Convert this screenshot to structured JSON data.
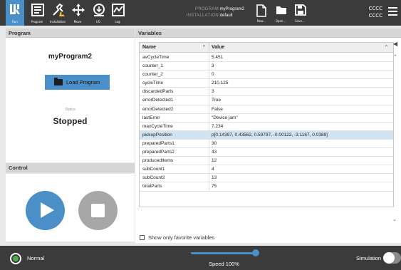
{
  "nav": {
    "run": "Run",
    "program": "Program",
    "installation": "Installation",
    "move": "Move",
    "io": "I/O",
    "log": "Log"
  },
  "header": {
    "program_label": "PROGRAM",
    "program_value": "myProgram2",
    "installation_label": "INSTALLATION",
    "installation_value": "default",
    "new_label": "New...",
    "open_label": "Open...",
    "save_label": "Save...",
    "right_line1": "CCCC",
    "right_line2": "CCCC"
  },
  "program_pane": {
    "title": "Program",
    "program_name": "myProgram2",
    "load_button": "Load Program",
    "status_label": "Status",
    "status_value": "Stopped"
  },
  "control_pane": {
    "title": "Control"
  },
  "variables": {
    "title": "Variables",
    "col_name": "Name",
    "col_value": "Value",
    "sort_glyph_name": "^",
    "sort_glyph_value": "^",
    "rows": [
      {
        "name": "avCycleTime",
        "value": "5.451"
      },
      {
        "name": "counter_1",
        "value": "3"
      },
      {
        "name": "counter_2",
        "value": "0"
      },
      {
        "name": "cycleTime",
        "value": "210.125"
      },
      {
        "name": "discardedParts",
        "value": "3"
      },
      {
        "name": "errorDetected1",
        "value": "True"
      },
      {
        "name": "errorDetected2",
        "value": "False"
      },
      {
        "name": "lastError",
        "value": "\"Device jam\""
      },
      {
        "name": "maxCycleTime",
        "value": "7.234"
      },
      {
        "name": "pickupPosition",
        "value": "p[0.14397, 0.43562, 0.59797, -0.00122, -3.1167, 0.0389]"
      },
      {
        "name": "preparedParts1",
        "value": "30"
      },
      {
        "name": "preparedParts2",
        "value": "43"
      },
      {
        "name": "producedItems",
        "value": "12"
      },
      {
        "name": "subCount1",
        "value": "4"
      },
      {
        "name": "subCount2",
        "value": "13"
      },
      {
        "name": "totalParts",
        "value": "75"
      }
    ],
    "favorite_label": "Show only favorite variables"
  },
  "footer": {
    "status_text": "Normal",
    "speed_text": "Speed 100%",
    "speed_percent": 100,
    "simulation_label": "Simulation"
  },
  "colors": {
    "accent": "#4a8fc7",
    "header_bg": "#3b3b3b",
    "selected_row": "#cfe3f3",
    "status_ok": "#4caf50"
  }
}
